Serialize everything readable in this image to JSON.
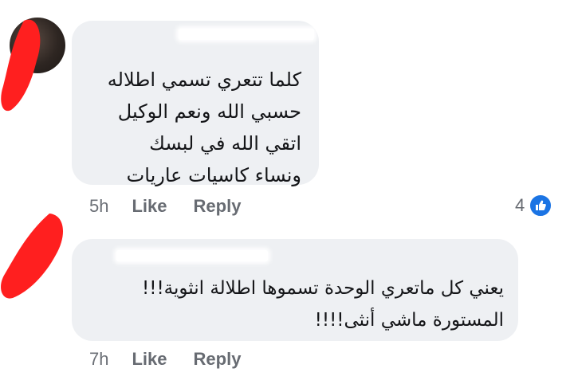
{
  "comments": [
    {
      "author": "",
      "lines": [
        "كلما تتعري تسمي اطلاله",
        "حسبي الله ونعم الوكيل",
        "اتقي الله في لبسك",
        "ونساء كاسيات عاريات"
      ],
      "time": "5h",
      "like_label": "Like",
      "reply_label": "Reply",
      "reaction_count": "4",
      "reaction_icon": "like-thumb-icon",
      "reaction_color": "#1b74e4"
    },
    {
      "author": "",
      "lines": [
        "يعني كل ماتعري الوحدة تسموها اطلالة انثوية!!!",
        "المستورة ماشي أنثى!!!!"
      ],
      "time": "7h",
      "like_label": "Like",
      "reply_label": "Reply"
    }
  ],
  "colors": {
    "bubble": "#eef0f3",
    "redaction": "#ff1f1f",
    "accent": "#1b74e4"
  }
}
